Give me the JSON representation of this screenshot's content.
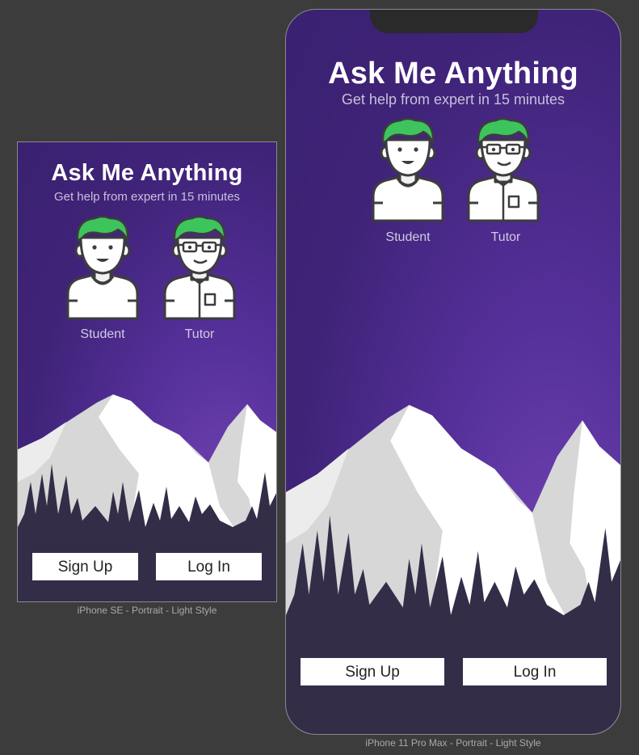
{
  "app": {
    "title": "Ask Me Anything",
    "subtitle": "Get help from expert in 15 minutes",
    "student_label": "Student",
    "tutor_label": "Tutor",
    "signup_label": "Sign Up",
    "login_label": "Log In"
  },
  "frames": {
    "se_caption": "iPhone SE - Portrait - Light Style",
    "max_caption": "iPhone 11 Pro Max - Portrait - Light Style"
  },
  "icons": {
    "student": "student-avatar-icon",
    "tutor": "tutor-avatar-icon",
    "scenery": "mountain-landscape-icon"
  },
  "colors": {
    "canvas": "#3c3c3c",
    "background_top": "#3f2378",
    "background_glow": "#7445b5",
    "hair": "#3ec45c",
    "trees": "#332d48",
    "button": "#ffffff"
  }
}
